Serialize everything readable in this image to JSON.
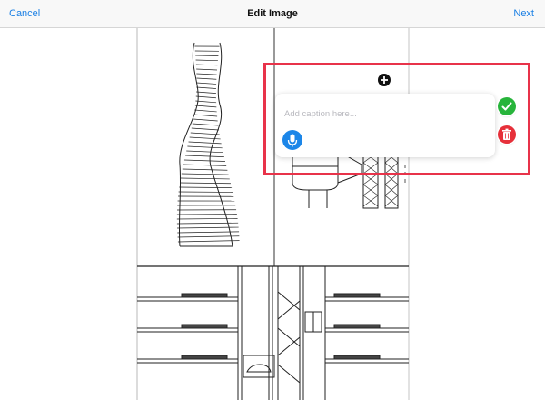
{
  "nav": {
    "cancel_label": "Cancel",
    "title": "Edit Image",
    "next_label": "Next"
  },
  "caption": {
    "placeholder": "Add caption here...",
    "value": ""
  },
  "icons": {
    "add": "plus-circle-icon",
    "mic": "microphone-icon",
    "confirm": "checkmark-icon",
    "delete": "trash-icon"
  },
  "colors": {
    "accent": "#1a7fe4",
    "highlight": "#e8334a",
    "confirm": "#27b43b",
    "delete": "#e6303a",
    "mic": "#1c86e8"
  }
}
